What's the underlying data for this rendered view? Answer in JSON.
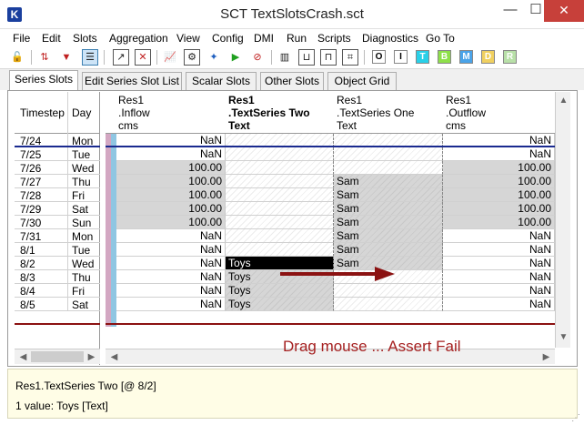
{
  "window": {
    "title": "SCT TextSlotsCrash.sct",
    "app_icon": "K",
    "minimize": "—",
    "maximize": "☐",
    "close": "✕"
  },
  "menu": [
    "File",
    "Edit",
    "Slots",
    "Aggregation",
    "View",
    "Config",
    "DMI",
    "Run",
    "Scripts",
    "Diagnostics",
    "Go To"
  ],
  "toolbar": {
    "letters": [
      "O",
      "I",
      "T",
      "B",
      "M",
      "D",
      "R"
    ],
    "letter_colors": [
      "#ffffff",
      "#ffffff",
      "#29d0e8",
      "#8ee04a",
      "#4aa3e8",
      "#f0d060",
      "#b8e0a8"
    ]
  },
  "tabs": [
    "Series Slots",
    "Edit Series Slot List",
    "Scalar Slots",
    "Other Slots",
    "Object Grid"
  ],
  "left_grid": {
    "headers": [
      "Timestep",
      "Day"
    ],
    "rows": [
      {
        "ts": "7/24",
        "day": "Mon"
      },
      {
        "ts": "7/25",
        "day": "Tue"
      },
      {
        "ts": "7/26",
        "day": "Wed"
      },
      {
        "ts": "7/27",
        "day": "Thu"
      },
      {
        "ts": "7/28",
        "day": "Fri"
      },
      {
        "ts": "7/29",
        "day": "Sat"
      },
      {
        "ts": "7/30",
        "day": "Sun"
      },
      {
        "ts": "7/31",
        "day": "Mon"
      },
      {
        "ts": "8/1",
        "day": "Tue"
      },
      {
        "ts": "8/2",
        "day": "Wed"
      },
      {
        "ts": "8/3",
        "day": "Thu"
      },
      {
        "ts": "8/4",
        "day": "Fri"
      },
      {
        "ts": "8/5",
        "day": "Sat"
      }
    ]
  },
  "columns": [
    {
      "line1": "Res1",
      "line2": ".Inflow",
      "line3": "cms"
    },
    {
      "line1": "Res1",
      "line2": ".TextSeries Two",
      "line3": "Text"
    },
    {
      "line1": "Res1",
      "line2": ".TextSeries One",
      "line3": "Text"
    },
    {
      "line1": "Res1",
      "line2": ".Outflow",
      "line3": "cms"
    }
  ],
  "cells": [
    [
      "NaN",
      "",
      "",
      "NaN"
    ],
    [
      "NaN",
      "",
      "",
      "NaN"
    ],
    [
      "100.00",
      "",
      "",
      "100.00"
    ],
    [
      "100.00",
      "",
      "Sam",
      "100.00"
    ],
    [
      "100.00",
      "",
      "Sam",
      "100.00"
    ],
    [
      "100.00",
      "",
      "Sam",
      "100.00"
    ],
    [
      "100.00",
      "",
      "Sam",
      "100.00"
    ],
    [
      "NaN",
      "",
      "Sam",
      "NaN"
    ],
    [
      "NaN",
      "",
      "Sam",
      "NaN"
    ],
    [
      "NaN",
      "Toys",
      "Sam",
      "NaN"
    ],
    [
      "NaN",
      "Toys",
      "",
      "NaN"
    ],
    [
      "NaN",
      "Toys",
      "",
      "NaN"
    ],
    [
      "NaN",
      "Toys",
      "",
      "NaN"
    ]
  ],
  "annotation": "Drag mouse ... Assert Fail",
  "status": {
    "line1": "Res1.TextSeries Two [@ 8/2]",
    "line2": "1 value:  Toys [Text]"
  },
  "colors": {
    "drag_arrow": "#8b1212",
    "annotation_text": "#a52020"
  }
}
